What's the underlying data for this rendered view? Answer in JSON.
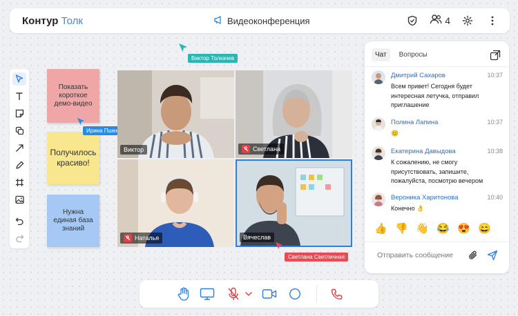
{
  "header": {
    "logo_main": "Контур",
    "logo_accent": "Толк",
    "title": "Видеоконференция",
    "participants_count": "4"
  },
  "icons": {
    "header": [
      "megaphone-icon",
      "shield-check-icon",
      "participants-icon",
      "gear-icon",
      "more-vertical-icon"
    ],
    "toolbar": [
      "pointer-icon",
      "text-icon",
      "sticky-note-icon",
      "copy-icon",
      "arrow-icon",
      "pen-icon",
      "frame-icon",
      "image-icon",
      "undo-icon",
      "redo-icon"
    ],
    "controls": [
      "raise-hand-icon",
      "screen-share-icon",
      "mic-off-icon",
      "chevron-down-icon",
      "camera-icon",
      "record-icon",
      "hang-up-icon"
    ]
  },
  "stickies": {
    "pink": "Показать короткое демо-видео",
    "yellow": "Получилось красиво!",
    "blue": "Нужна единая база знаний"
  },
  "cursors": {
    "top": "Виктор Толкачев",
    "left": "Ирина Пшеничная",
    "bottom": "Светлана Светличная"
  },
  "video": {
    "tiles": [
      {
        "name": "Виктор",
        "muted": false
      },
      {
        "name": "Светлана",
        "muted": true
      },
      {
        "name": "Наталья",
        "muted": true
      },
      {
        "name": "Вячеслав",
        "muted": false,
        "active_speaker": true
      }
    ]
  },
  "chat": {
    "tabs": [
      "Чат",
      "Вопросы"
    ],
    "active_tab": "Чат",
    "messages": [
      {
        "author": "Дмитрий Сахаров",
        "time": "10:37",
        "text": "Всем привет! Сегодня будет интересная летучка, отправил приглашение"
      },
      {
        "author": "Полина Лапина",
        "time": "10:37",
        "text": "😊"
      },
      {
        "author": "Екатерина Давыдова",
        "time": "10:38",
        "text": "К сожалению, не смогу присутствовать, запишите, пожалуйста, посмотрю вечером"
      },
      {
        "author": "Вероника Харитонова",
        "time": "10:40",
        "text": "Конечно 👌"
      }
    ],
    "reactions": [
      "👍",
      "👎",
      "👋",
      "😂",
      "😍",
      "😄"
    ],
    "input_placeholder": "Отправить сообщение"
  },
  "colors": {
    "accent": "#3b8bdd",
    "mute_red": "#e23e45",
    "cursor_blue": "#2a8be6",
    "cursor_teal": "#2bb5b5",
    "cursor_red": "#e94b55",
    "active_border": "#2a7ee8"
  }
}
